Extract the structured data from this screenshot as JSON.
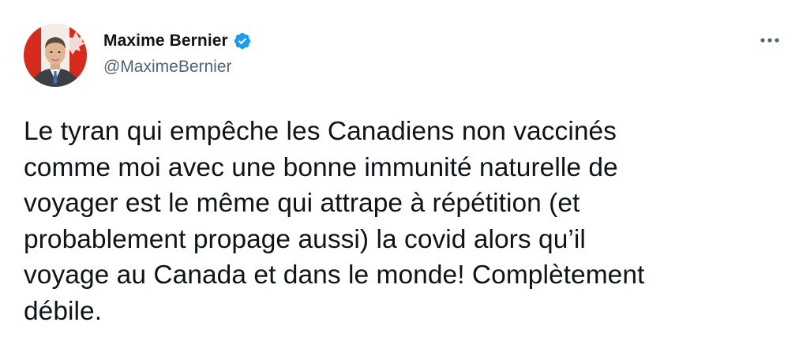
{
  "author": {
    "display_name": "Maxime Bernier",
    "handle": "@MaximeBernier",
    "verified": true,
    "avatar_icon": "profile-photo",
    "verified_icon": "verified-badge-icon"
  },
  "menu": {
    "more_icon": "more-horizontal-icon"
  },
  "tweet": {
    "text": "Le tyran qui empêche les Canadiens non vaccinés\ncomme moi avec une bonne immunité naturelle de\nvoyager est le même qui attrape à répétition (et\nprobablement propage aussi) la covid alors qu’il\nvoyage au Canada et dans le monde! Complètement\ndébile."
  },
  "colors": {
    "text_primary": "#0f1419",
    "text_secondary": "#536471",
    "verified_blue": "#1d9bf0",
    "flag_red": "#d52b1e"
  }
}
